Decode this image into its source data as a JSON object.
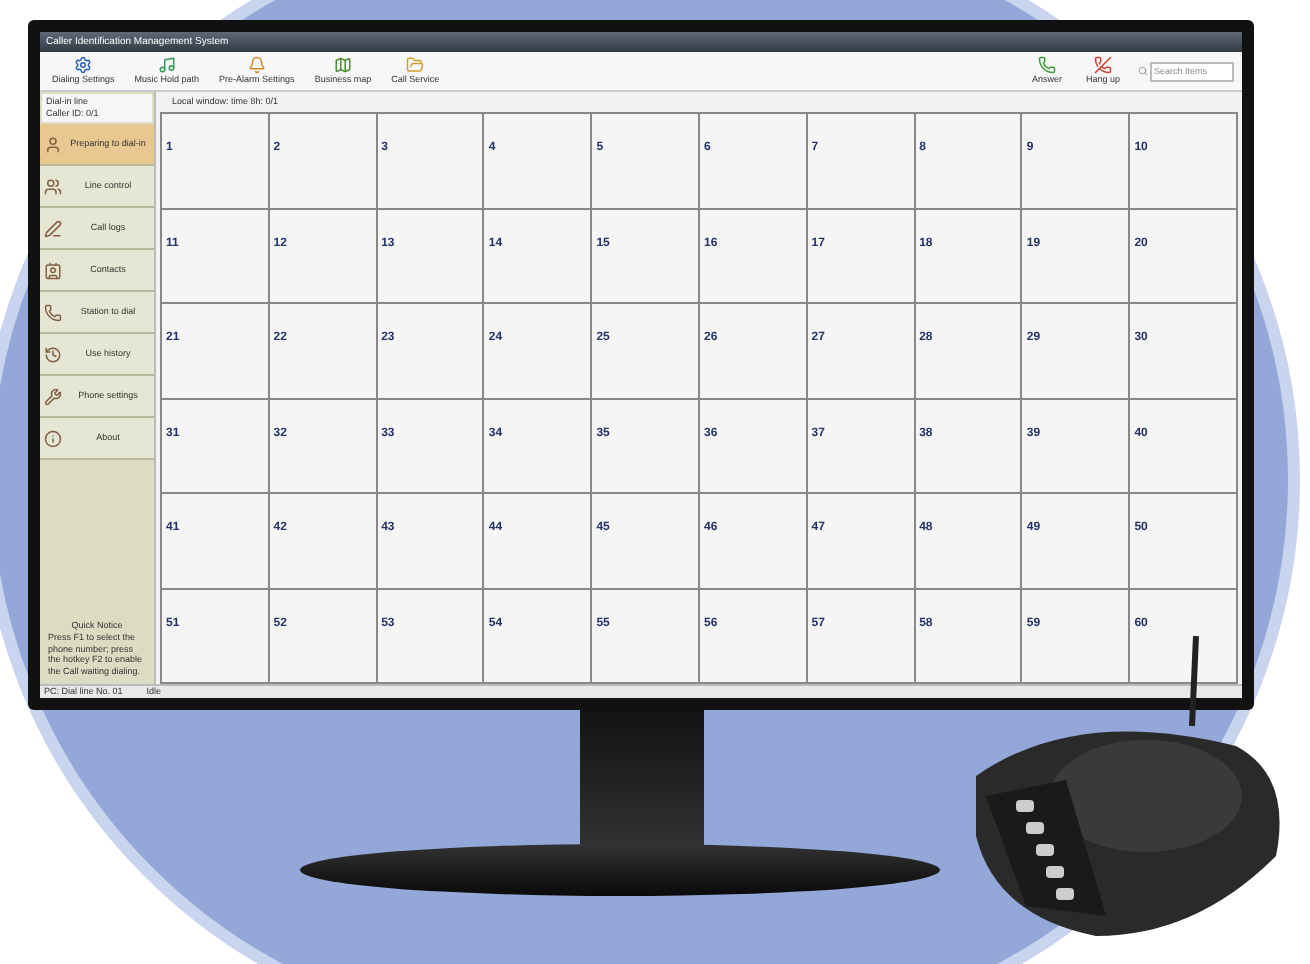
{
  "window": {
    "title": "Caller Identification Management System"
  },
  "toolbar": [
    {
      "label": "Dialing Settings",
      "kind": "gear"
    },
    {
      "label": "Music Hold path",
      "kind": "music"
    },
    {
      "label": "Pre-Alarm Settings",
      "kind": "bell"
    },
    {
      "label": "Business map",
      "kind": "map"
    },
    {
      "label": "Call Service",
      "kind": "folder"
    }
  ],
  "call_buttons": [
    {
      "label": "Answer",
      "kind": "answer"
    },
    {
      "label": "Hang up",
      "kind": "hangup"
    }
  ],
  "search": {
    "placeholder": "Search Items"
  },
  "sidebar": {
    "header": [
      "Dial-in line",
      "Caller ID: 0/1"
    ],
    "items": [
      {
        "label": "Preparing to dial-in",
        "selected": true,
        "kind": "person"
      },
      {
        "label": "Line control",
        "kind": "people",
        "selected": false
      },
      {
        "label": "Call logs",
        "kind": "pen",
        "selected": false
      },
      {
        "label": "Contacts",
        "kind": "contact",
        "selected": false
      },
      {
        "label": "Station to dial",
        "kind": "phone",
        "selected": false
      },
      {
        "label": "Use history",
        "kind": "history",
        "selected": false
      },
      {
        "label": "Phone settings",
        "kind": "settings",
        "selected": false
      },
      {
        "label": "About",
        "kind": "info",
        "selected": false
      }
    ],
    "notice_title": "Quick Notice",
    "notice": "Press F1 to select the phone number; press the hotkey F2 to enable the Call waiting dialing."
  },
  "grid": {
    "header": "Local window: time 8h: 0/1",
    "cells": [
      "1",
      "2",
      "3",
      "4",
      "5",
      "6",
      "7",
      "8",
      "9",
      "10",
      "11",
      "12",
      "13",
      "14",
      "15",
      "16",
      "17",
      "18",
      "19",
      "20",
      "21",
      "22",
      "23",
      "24",
      "25",
      "26",
      "27",
      "28",
      "29",
      "30",
      "31",
      "32",
      "33",
      "34",
      "35",
      "36",
      "37",
      "38",
      "39",
      "40",
      "41",
      "42",
      "43",
      "44",
      "45",
      "46",
      "47",
      "48",
      "49",
      "50",
      "51",
      "52",
      "53",
      "54",
      "55",
      "56",
      "57",
      "58",
      "59",
      "60"
    ]
  },
  "status_bar": [
    "PC: Dial line No. 01",
    "Idle"
  ]
}
